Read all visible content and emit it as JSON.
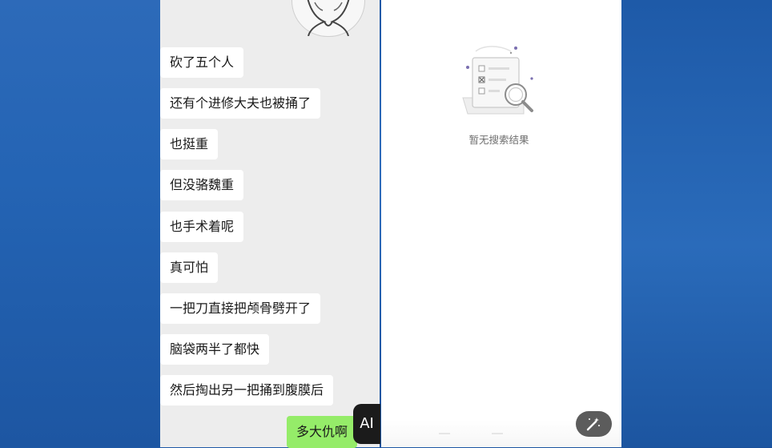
{
  "chat": {
    "messages": [
      "砍了五个人",
      "还有个进修大夫也被捅了",
      "也挺重",
      "但没骆魏重",
      "也手术着呢",
      "真可怕",
      "一把刀直接把颅骨劈开了",
      "脑袋两半了都快",
      "然后掏出另一把捅到腹膜后"
    ],
    "my_message": "多大仇啊",
    "ai_badge": "AI"
  },
  "search": {
    "empty_text": "暂无搜索结果"
  },
  "colors": {
    "chat_bg": "#ededed",
    "incoming_bubble": "#ffffff",
    "outgoing_bubble": "#95ec69",
    "desktop_blue": "#1f5aa8",
    "illustration_accent": "#7b6fb0"
  },
  "icons": {
    "sticker": "cartoon-sticker-icon",
    "empty_state": "checklist-magnifier-icon",
    "magic": "magic-wand-icon"
  }
}
